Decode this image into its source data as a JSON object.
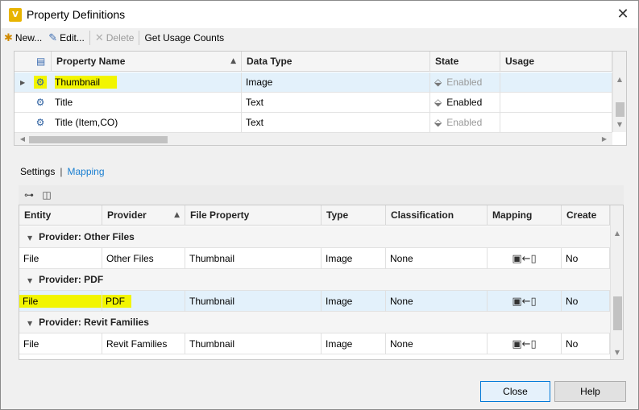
{
  "window": {
    "title": "Property Definitions",
    "icon_letter": "V"
  },
  "toolbar": {
    "new_label": "New...",
    "edit_label": "Edit...",
    "delete_label": "Delete",
    "usage_label": "Get Usage Counts"
  },
  "properties": {
    "headers": [
      "Property Name",
      "Data Type",
      "State",
      "Usage"
    ],
    "rows": [
      {
        "name": "Thumbnail",
        "type": "Image",
        "state": "Enabled",
        "usage": "",
        "state_dim": true,
        "selected": true
      },
      {
        "name": "Title",
        "type": "Text",
        "state": "Enabled",
        "usage": "",
        "state_dim": false,
        "selected": false
      },
      {
        "name": "Title (Item,CO)",
        "type": "Text",
        "state": "Enabled",
        "usage": "",
        "state_dim": true,
        "selected": false
      }
    ]
  },
  "tabs": {
    "settings": "Settings",
    "separator": "|",
    "mapping": "Mapping"
  },
  "mapping": {
    "headers": [
      "Entity",
      "Provider",
      "File Property",
      "Type",
      "Classification",
      "Mapping",
      "Create"
    ],
    "groups": [
      {
        "label": "Provider: Other Files",
        "row": {
          "entity": "File",
          "provider": "Other Files",
          "file_property": "Thumbnail",
          "type": "Image",
          "classification": "None",
          "create": "No"
        }
      },
      {
        "label": "Provider: PDF",
        "row": {
          "entity": "File",
          "provider": "PDF",
          "file_property": "Thumbnail",
          "type": "Image",
          "classification": "None",
          "create": "No"
        }
      },
      {
        "label": "Provider: Revit Families",
        "row": {
          "entity": "File",
          "provider": "Revit Families",
          "file_property": "Thumbnail",
          "type": "Image",
          "classification": "None",
          "create": "No"
        }
      }
    ]
  },
  "buttons": {
    "close": "Close",
    "help": "Help"
  },
  "colors": {
    "highlight": "#f2f500",
    "selection": "#e3f1fb",
    "link": "#1a7fd1",
    "primary_border": "#0078d7"
  },
  "icons": {
    "close": "close-icon",
    "new": "new-icon",
    "edit": "edit-icon",
    "delete": "delete-icon",
    "mapping": "file-to-property-icon"
  }
}
